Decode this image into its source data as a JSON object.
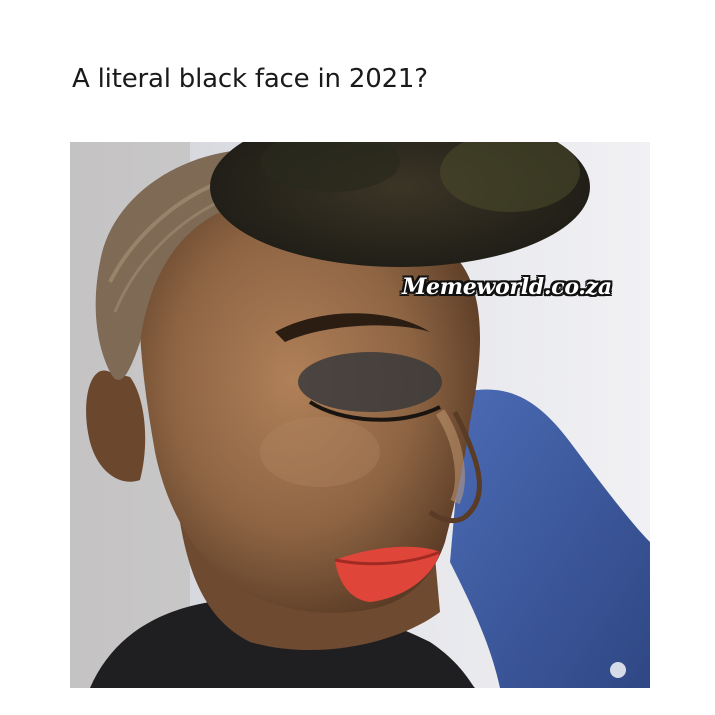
{
  "post": {
    "caption": "A literal black face in 2021?",
    "watermark": "Memeworld.co.za"
  },
  "colors": {
    "background": "#ffffff",
    "caption_text": "#1a1a1a",
    "skin": "#8a6342",
    "lips": "#e0453a",
    "sleeve": "#3f5ea8",
    "backdrop": "#e8e9ee"
  },
  "photo": {
    "subject": "photo",
    "watermark_style": "white italic bold with black outline"
  }
}
